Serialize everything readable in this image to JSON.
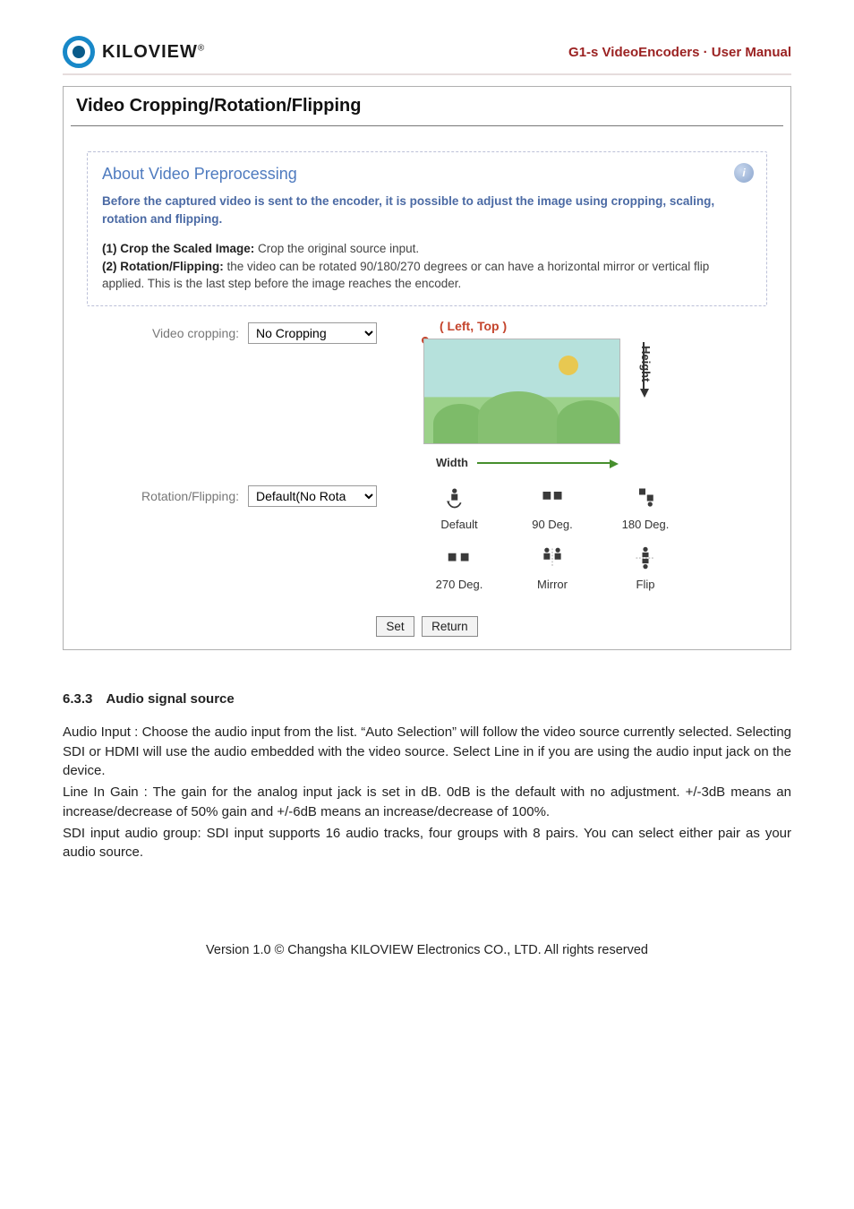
{
  "header": {
    "brand": "KILOVIEW",
    "brand_suffix": "®",
    "right": "G1-s VideoEncoders · User Manual"
  },
  "panel": {
    "title": "Video Cropping/Rotation/Flipping"
  },
  "about": {
    "title": "About Video Preprocessing",
    "lead": "Before the captured video is sent to the encoder, it is possible to adjust the image using cropping, scaling, rotation and flipping.",
    "item1_label": "(1) Crop the Scaled Image:",
    "item1_text": " Crop the original source input.",
    "item2_label": "(2) Rotation/Flipping:",
    "item2_text": " the video can be rotated 90/180/270 degrees or can have a horizontal mirror or vertical flip applied. This is the last step before the image reaches the encoder."
  },
  "form": {
    "cropping_label": "Video cropping:",
    "cropping_value": "No Cropping",
    "rotation_label": "Rotation/Flipping:",
    "rotation_value": "Default(No Rota",
    "preview": {
      "lt": "( Left, Top )",
      "height": "Height",
      "width": "Width"
    },
    "rot_options": {
      "r0": "Default",
      "r1": "90 Deg.",
      "r2": "180 Deg.",
      "r3": "270 Deg.",
      "r4": "Mirror",
      "r5": "Flip"
    },
    "buttons": {
      "set": "Set",
      "return": "Return"
    }
  },
  "section": {
    "heading": "6.3.3 Audio signal source",
    "p1": "Audio Input : Choose the audio input from the list. “Auto Selection” will follow the video source currently selected. Selecting SDI or HDMI will use the audio embedded with the video source. Select Line in if you are using the audio input jack on the device.",
    "p2": "Line In Gain : The gain for the analog input jack is set in dB. 0dB is the default with no adjustment. +/-3dB means an increase/decrease of 50% gain and +/-6dB means an increase/decrease of 100%.",
    "p3": "SDI input audio group: SDI input supports 16 audio tracks, four groups with 8 pairs. You can select either pair as your audio source."
  },
  "footer": "Version 1.0 © Changsha KILOVIEW Electronics CO., LTD. All rights reserved"
}
